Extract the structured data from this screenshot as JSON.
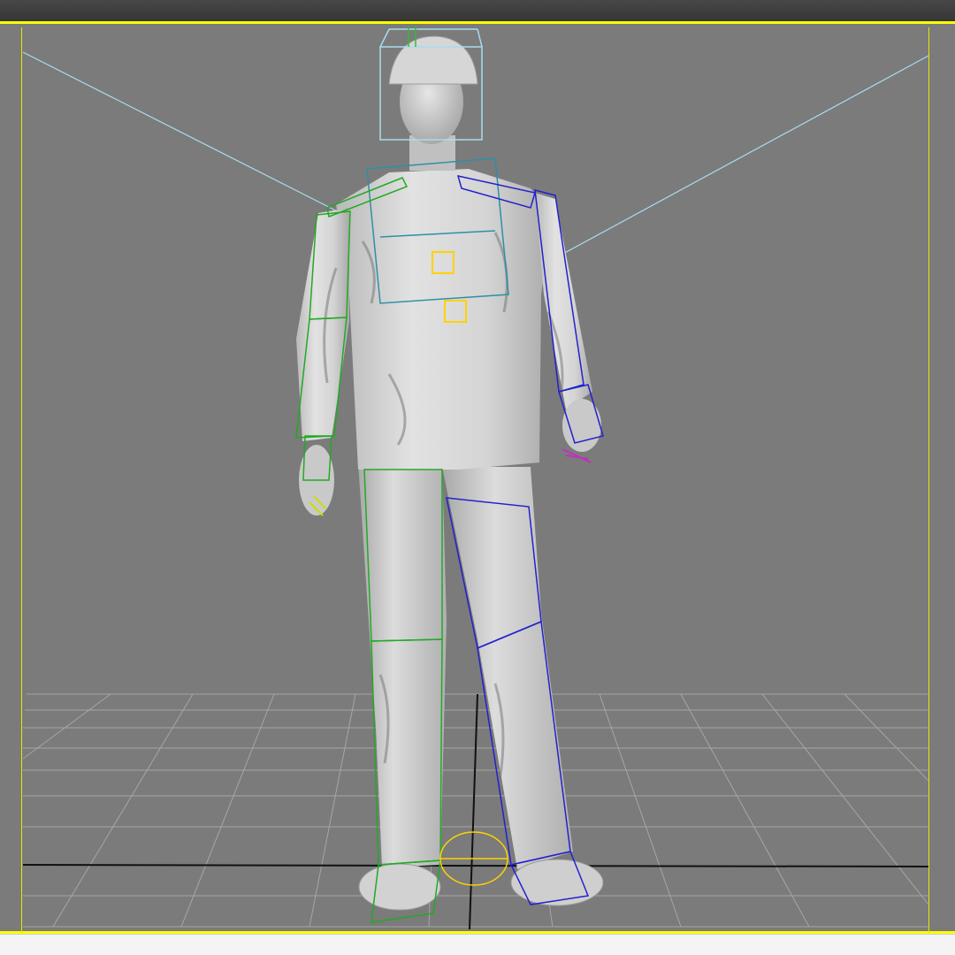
{
  "app": {
    "title": "",
    "active_viewport": "perspective"
  },
  "viewport": {
    "background_color": "#7b7b7b",
    "active_border_color": "#ffff00",
    "grid_color": "#a6a6a6",
    "axis_color": "#111111"
  },
  "scene": {
    "object": "construction-worker-figure",
    "rig": {
      "left_side_color": "#22aa22",
      "right_side_color": "#2222cc",
      "spine_color": "#2f8fa6",
      "head_color": "#a8dcef",
      "com_color": "#ffd200",
      "hand_highlight_color": "#c030c0"
    }
  }
}
